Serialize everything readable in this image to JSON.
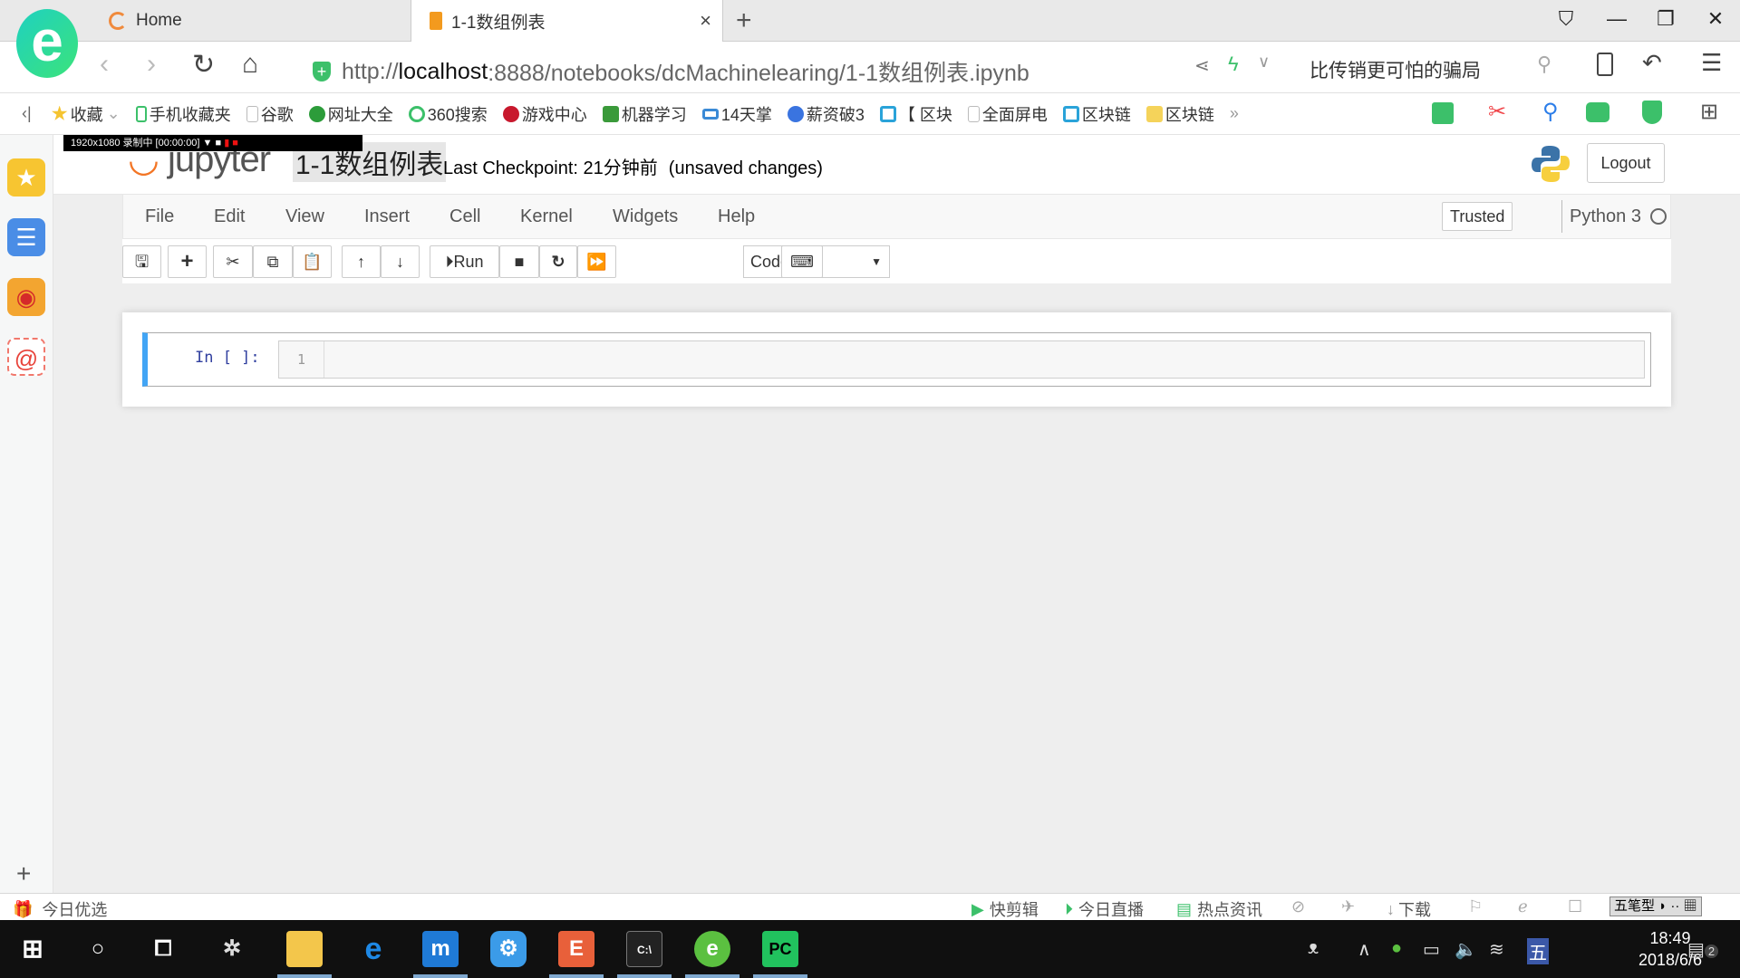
{
  "browser": {
    "tabs": [
      {
        "label": "Home",
        "active": false
      },
      {
        "label": "1-1数组例表",
        "active": true
      }
    ],
    "url_prefix": "http://",
    "url_host": "localhost",
    "url_rest": ":8888/notebooks/dcMachinelearing/1-1数组例表.ipynb",
    "search_text": "比传销更可怕的骗局",
    "bookmarks": [
      "收藏",
      "手机收藏夹",
      "谷歌",
      "网址大全",
      "360搜索",
      "游戏中心",
      "机器学习",
      "14天掌",
      "薪资破3",
      "【 区块",
      "全面屏电",
      "区块链",
      "区块链"
    ],
    "bookmark_more": "»",
    "recorder_text": "1920x1080   录制中 [00:00:00]"
  },
  "jupyter": {
    "logo_text": "jupyter",
    "notebook_title": "1-1数组例表",
    "checkpoint": "Last Checkpoint: 21分钟前",
    "unsaved": "(unsaved changes)",
    "logout": "Logout",
    "menu": [
      "File",
      "Edit",
      "View",
      "Insert",
      "Cell",
      "Kernel",
      "Widgets",
      "Help"
    ],
    "trusted": "Trusted",
    "kernel_name": "Python 3",
    "run_label": "Run",
    "cell_type": "Code",
    "cell": {
      "prompt": "In [ ]:",
      "line_number": "1",
      "source": ""
    }
  },
  "statusbar": {
    "left": "今日优选",
    "items": [
      "快剪辑",
      "今日直播",
      "热点资讯",
      "下载"
    ],
    "ime": "五笔型"
  },
  "taskbar": {
    "time": "18:49",
    "date": "2018/6/6",
    "notifications": "2"
  },
  "colors": {
    "accent": "#42a5f5",
    "jupyter_orange": "#f37626",
    "prompt": "#303f9f"
  }
}
